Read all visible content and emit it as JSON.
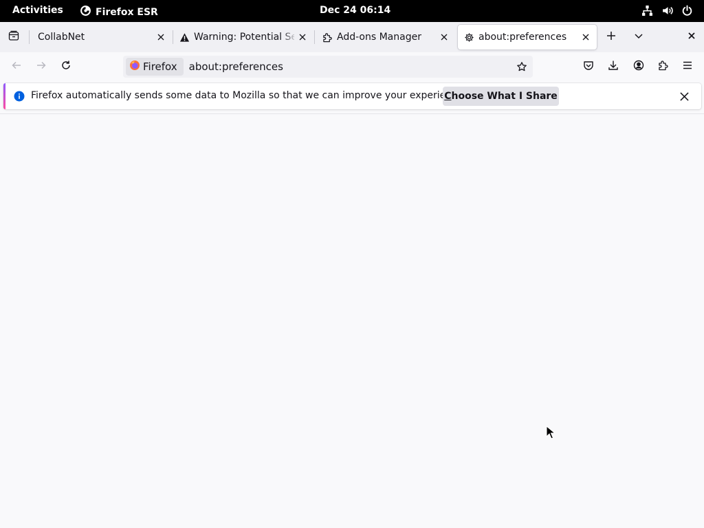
{
  "system_bar": {
    "activities": "Activities",
    "app_name": "Firefox ESR",
    "clock": "Dec 24  06:14",
    "tray_icons": [
      "network-icon",
      "volume-icon",
      "power-icon"
    ]
  },
  "tabs": [
    {
      "title": "CollabNet",
      "icon": "none",
      "active": false
    },
    {
      "title": "Warning: Potential Sec",
      "icon": "warning-icon",
      "active": false
    },
    {
      "title": "Add-ons Manager",
      "icon": "puzzle-icon",
      "active": false
    },
    {
      "title": "about:preferences",
      "icon": "gear-icon",
      "active": true
    }
  ],
  "urlbar": {
    "identity_label": "Firefox",
    "url": "about:preferences"
  },
  "notification": {
    "message": "Firefox automatically sends some data to Mozilla so that we can improve your experience.",
    "button_accesskey": "C",
    "button_label_rest": "hoose What I Share"
  },
  "colors": {
    "accent": "#0060df",
    "chrome_bg": "#f0f0f4",
    "content_bg": "#f9f9fb",
    "notification_stripe": [
      "#9059ff",
      "#ff4aa2"
    ]
  }
}
